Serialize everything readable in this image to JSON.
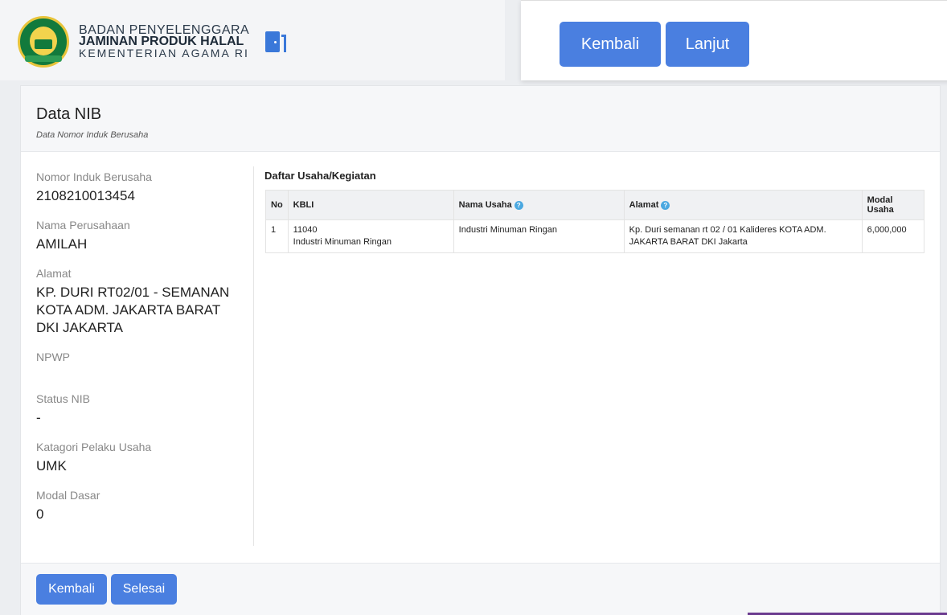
{
  "brand": {
    "line1": "BADAN PENYELENGGARA",
    "line2": "JAMINAN PRODUK HALAL",
    "line3": "KEMENTERIAN AGAMA RI"
  },
  "popup": {
    "back_label": "Kembali",
    "next_label": "Lanjut"
  },
  "card": {
    "title": "Data NIB",
    "subtitle": "Data Nomor Induk Berusaha"
  },
  "fields": [
    {
      "label": "Nomor Induk Berusaha",
      "value": "2108210013454"
    },
    {
      "label": "Nama Perusahaan",
      "value": "AMILAH"
    },
    {
      "label": "Alamat",
      "value": "KP. DURI RT02/01 - SEMANAN KOTA ADM. JAKARTA BARAT DKI JAKARTA"
    },
    {
      "label": "NPWP",
      "value": ""
    },
    {
      "label": "Status NIB",
      "value": "-"
    },
    {
      "label": "Katagori Pelaku Usaha",
      "value": "UMK"
    },
    {
      "label": "Modal Dasar",
      "value": "0"
    }
  ],
  "activities": {
    "title": "Daftar Usaha/Kegiatan",
    "columns": [
      "No",
      "KBLI",
      "Nama Usaha",
      "Alamat",
      "Modal Usaha"
    ],
    "rows": [
      {
        "no": "1",
        "kbli_code": "11040",
        "kbli_name": "Industri Minuman Ringan",
        "nama_usaha": "Industri Minuman Ringan",
        "alamat": "Kp. Duri semanan rt 02 / 01 Kalideres KOTA ADM. JAKARTA BARAT DKI Jakarta",
        "modal": "6,000,000"
      }
    ]
  },
  "footer": {
    "back_label": "Kembali",
    "finish_label": "Selesai"
  },
  "colors": {
    "primary": "#4a7fe0",
    "brand_green": "#127a3c"
  }
}
